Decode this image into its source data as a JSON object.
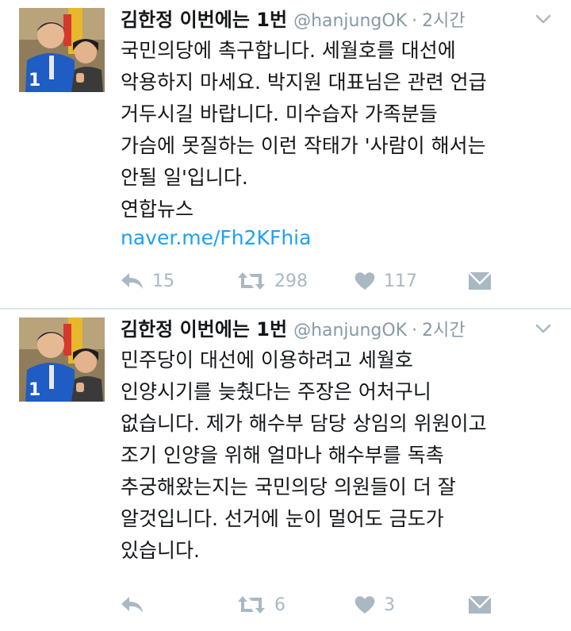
{
  "tweets": [
    {
      "name": "김한정 이번에는 1번",
      "handle": "@hanjungOK",
      "separator": "·",
      "time": "2시간",
      "text": "국민의당에 촉구합니다. 세월호를 대선에\n악용하지 마세요. 박지원 대표님은 관련 언급\n거두시길 바랍니다. 미수습자 가족분들\n가슴에 못질하는 이런 작태가 '사람이 해서는\n안될 일'입니다.\n연합뉴스",
      "link": "naver.me/Fh2KFhia",
      "replies": "15",
      "retweets": "298",
      "likes": "117"
    },
    {
      "name": "김한정 이번에는 1번",
      "handle": "@hanjungOK",
      "separator": "·",
      "time": "2시간",
      "text": "민주당이 대선에 이용하려고 세월호\n인양시기를 늦췄다는 주장은 어처구니\n없습니다. 제가 해수부 담당 상임의 위원이고\n조기 인양을 위해 얼마나 해수부를 독촉\n추궁해왔는지는 국민의당 의원들이 더 잘\n알것입니다. 선거에 눈이 멀어도 금도가\n있습니다.",
      "link": "",
      "replies": "",
      "retweets": "6",
      "likes": "3"
    }
  ],
  "icons": {
    "avatar": "avatar-photo",
    "caret": "chevron-down-icon",
    "reply": "reply-icon",
    "retweet": "retweet-icon",
    "like": "heart-icon",
    "dm": "envelope-icon"
  },
  "colors": {
    "link": "#1da1f2",
    "muted": "#8899a6",
    "icon": "#aab8c2",
    "text": "#14171a"
  }
}
